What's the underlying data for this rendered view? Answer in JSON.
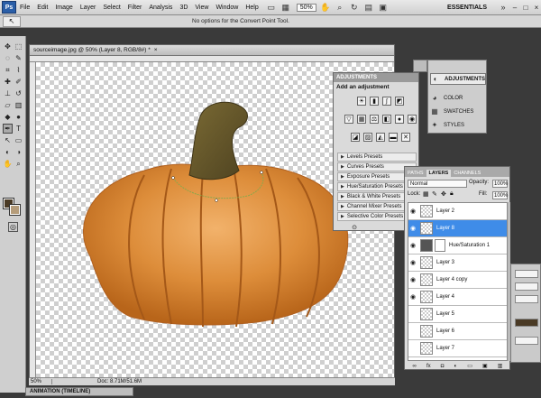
{
  "menu": {
    "logo": "Ps",
    "items": [
      "File",
      "Edit",
      "Image",
      "Layer",
      "Select",
      "Filter",
      "Analysis",
      "3D",
      "View",
      "Window",
      "Help"
    ],
    "zoom": "50%",
    "workspace": "ESSENTIALS",
    "win_min": "–",
    "win_max": "□",
    "win_close": "×"
  },
  "options": {
    "message": "No options for the Convert Point Tool."
  },
  "document": {
    "title": "sourceimage.jpg @ 50% (Layer 8, RGB/8#) *",
    "close": "×",
    "status_zoom": "50%",
    "status_doc": "Doc: 8.71M/51.6M"
  },
  "bottom_tab": "ANIMATION (TIMELINE)",
  "adjustments": {
    "tab": "ADJUSTMENTS",
    "title": "Add an adjustment",
    "presets": [
      "Levels Presets",
      "Curves Presets",
      "Exposure Presets",
      "Hue/Saturation Presets",
      "Black & White Presets",
      "Channel Mixer Presets",
      "Selective Color Presets"
    ]
  },
  "dock": {
    "items": [
      "ADJUSTMENTS",
      "COLOR",
      "SWATCHES",
      "STYLES"
    ]
  },
  "layers": {
    "tabs": [
      "PATHS",
      "LAYERS",
      "CHANNELS"
    ],
    "blend_mode": "Normal",
    "opacity_label": "Opacity:",
    "opacity": "100%",
    "lock_label": "Lock:",
    "fill_label": "Fill:",
    "fill": "100%",
    "rows": [
      {
        "name": "Layer 2",
        "selected": false
      },
      {
        "name": "Layer 8",
        "selected": true
      },
      {
        "name": "Hue/Saturation 1",
        "selected": false,
        "adjustment": true
      },
      {
        "name": "Layer 3",
        "selected": false
      },
      {
        "name": "Layer 4 copy",
        "selected": false
      },
      {
        "name": "Layer 4",
        "selected": false
      },
      {
        "name": "Layer 5",
        "selected": false
      },
      {
        "name": "Layer 6",
        "selected": false
      },
      {
        "name": "Layer 7",
        "selected": false
      }
    ]
  },
  "colors": {
    "accent": "#3f8ce8",
    "pumpkin": "#d9822b",
    "stem": "#6b5a2a",
    "fg": "#4a3a25",
    "bg": "#b59c7a"
  }
}
